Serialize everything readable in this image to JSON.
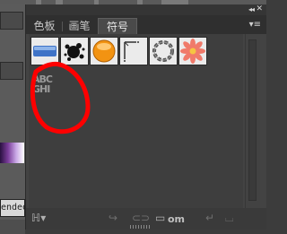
{
  "underlying_window": {
    "tab_text": "ended"
  },
  "panel": {
    "tabs": [
      {
        "label": "色板"
      },
      {
        "label": "画笔"
      },
      {
        "label": "符号"
      }
    ],
    "active_tab": "符号",
    "collapse_glyph": "◂◂",
    "close_glyph": "✕",
    "menu_glyph": "▾≡",
    "symbols": [
      {
        "name": "blue-banner-symbol"
      },
      {
        "name": "ink-splat-symbol"
      },
      {
        "name": "orange-orb-symbol"
      },
      {
        "name": "corner-frame-symbol"
      },
      {
        "name": "chain-ring-symbol"
      },
      {
        "name": "flower-symbol"
      },
      {
        "name": "abc-ghi-text-symbol",
        "line1": "ABC",
        "line2": "GHI"
      }
    ],
    "footer": {
      "library_glyph": "ℍ▾",
      "watermark_text": "om"
    },
    "annotation_color": "#ff0000"
  }
}
